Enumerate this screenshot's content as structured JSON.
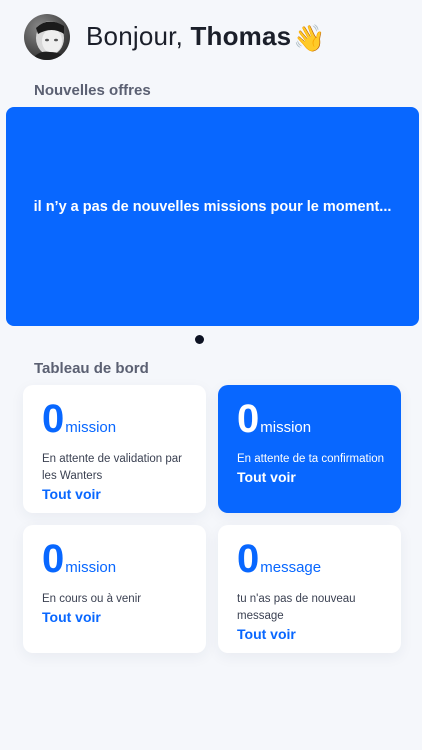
{
  "header": {
    "greeting_prefix": "Bonjour, ",
    "user_name": "Thomas",
    "emoji": "👋"
  },
  "offers": {
    "title": "Nouvelles offres",
    "empty_message": "il n’y a pas de nouvelles missions pour le moment...",
    "page_count": 1,
    "active_page": 1
  },
  "dashboard": {
    "title": "Tableau de bord",
    "cards": [
      {
        "count": "0",
        "unit": "mission",
        "description": "En attente de validation par les Wanters",
        "link": "Tout voir",
        "highlighted": false
      },
      {
        "count": "0",
        "unit": "mission",
        "description": "En attente de ta confirmation",
        "link": "Tout voir",
        "highlighted": true
      },
      {
        "count": "0",
        "unit": "mission",
        "description": "En cours ou à venir",
        "link": "Tout voir",
        "highlighted": false
      },
      {
        "count": "0",
        "unit": "message",
        "description": "tu n'as pas de nouveau message",
        "link": "Tout voir",
        "highlighted": false
      }
    ]
  },
  "colors": {
    "accent": "#0867ff",
    "background": "#f5f7fb",
    "text_dark": "#1b1f2a",
    "section_label": "#5b6072"
  }
}
